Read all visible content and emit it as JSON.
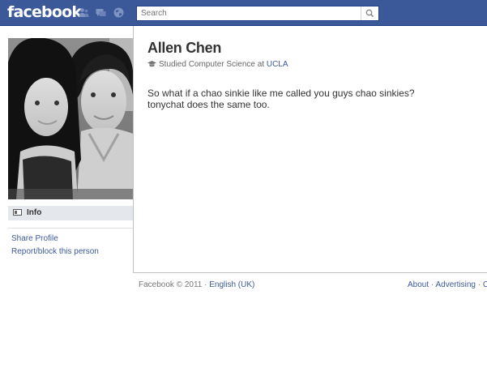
{
  "app": {
    "logo": "facebook",
    "brand_color": "#3b5998"
  },
  "topbar": {
    "search_placeholder": "Search",
    "icons": [
      "friend-requests-icon",
      "messages-icon",
      "notifications-icon",
      "search-icon"
    ]
  },
  "profile": {
    "name": "Allen Chen",
    "education_prefix": "Studied Computer Science at ",
    "education_school": "UCLA",
    "post_lines": [
      "So what if a chao sinkie like me called you guys chao sinkies?",
      "tonychat does the same too."
    ]
  },
  "sidebar": {
    "info_label": "Info",
    "links": [
      "Share Profile",
      "Report/block this person"
    ]
  },
  "footer": {
    "copyright": "Facebook © 2011 · ",
    "language": "English (UK)",
    "right_links": [
      "About",
      "Advertising",
      "Cr"
    ],
    "separator": " · "
  }
}
